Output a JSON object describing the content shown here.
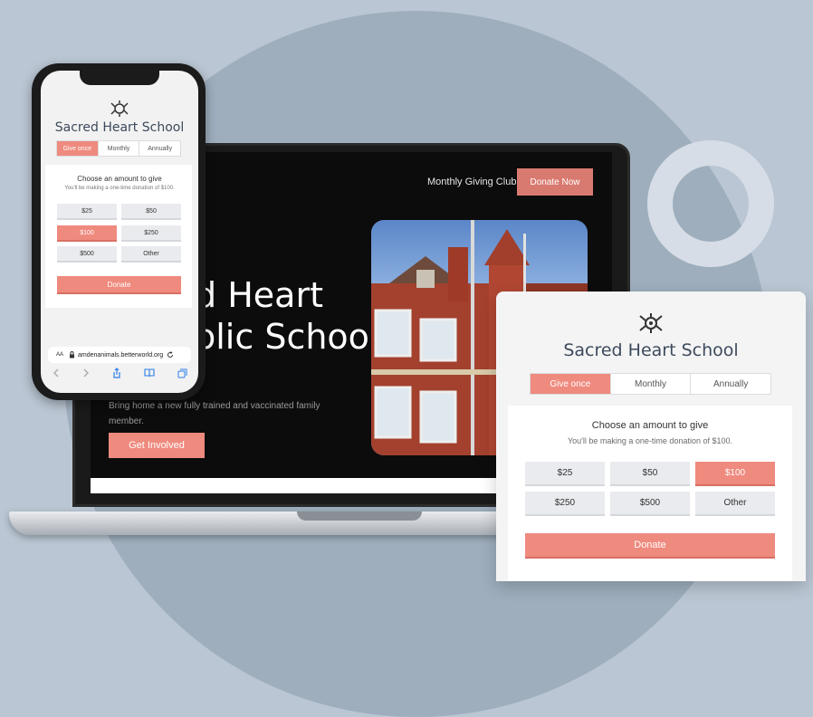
{
  "laptop": {
    "nav_link": "Monthly Giving Club",
    "donate_now": "Donate Now",
    "hero_title_line1": "d Heart",
    "hero_title_line2": "olic School",
    "hero_subtitle": "Bring home a new fully trained and vaccinated family member.",
    "cta": "Get Involved"
  },
  "phone": {
    "school_name": "Sacred Heart School",
    "tabs": [
      "Give once",
      "Monthly",
      "Annually"
    ],
    "active_tab": "Give once",
    "heading": "Choose an amount to give",
    "subheading": "You'll be making a one-time donation of $100.",
    "amounts": [
      "$25",
      "$50",
      "$100",
      "$250",
      "$500",
      "Other"
    ],
    "selected_amount": "$100",
    "donate": "Donate",
    "url_prefix": "AA",
    "url": "amdenanimals.betterworld.org"
  },
  "card": {
    "school_name": "Sacred Heart School",
    "tabs": [
      "Give once",
      "Monthly",
      "Annually"
    ],
    "active_tab": "Give once",
    "heading": "Choose an amount to give",
    "subheading": "You'll be making a one-time donation of $100.",
    "amounts": [
      "$25",
      "$50",
      "$100",
      "$250",
      "$500",
      "Other"
    ],
    "selected_amount": "$100",
    "donate": "Donate"
  },
  "colors": {
    "accent": "#ef8a7e",
    "background": "#bac6d3",
    "title_text": "#3d4a5c"
  },
  "icons": [
    "crest-logo-icon",
    "lock-icon",
    "reload-icon",
    "back-arrow-icon",
    "forward-arrow-icon",
    "share-icon",
    "bookmarks-icon",
    "tabs-icon"
  ]
}
